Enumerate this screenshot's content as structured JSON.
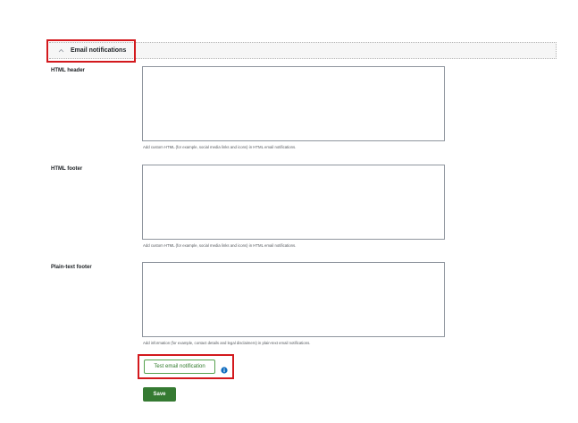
{
  "section": {
    "title": "Email notifications",
    "toggle_icon": "chevron-up-icon"
  },
  "fields": [
    {
      "label": "HTML header",
      "value": "",
      "help": "Add custom HTML (for example, social media links and icons) in HTML email notifications."
    },
    {
      "label": "HTML footer",
      "value": "",
      "help": "Add custom HTML (for example, social media links and icons) in HTML email notifications."
    },
    {
      "label": "Plain-text footer",
      "value": "",
      "help": "Add information (for example, contact details and legal disclaimers) in plain-text email notifications."
    }
  ],
  "actions": {
    "test_label": "Test email notification",
    "info_icon": "info-icon",
    "save_label": "Save"
  },
  "colors": {
    "primary": "#357a32",
    "info": "#0f6cbf",
    "highlight": "#d3191d"
  }
}
